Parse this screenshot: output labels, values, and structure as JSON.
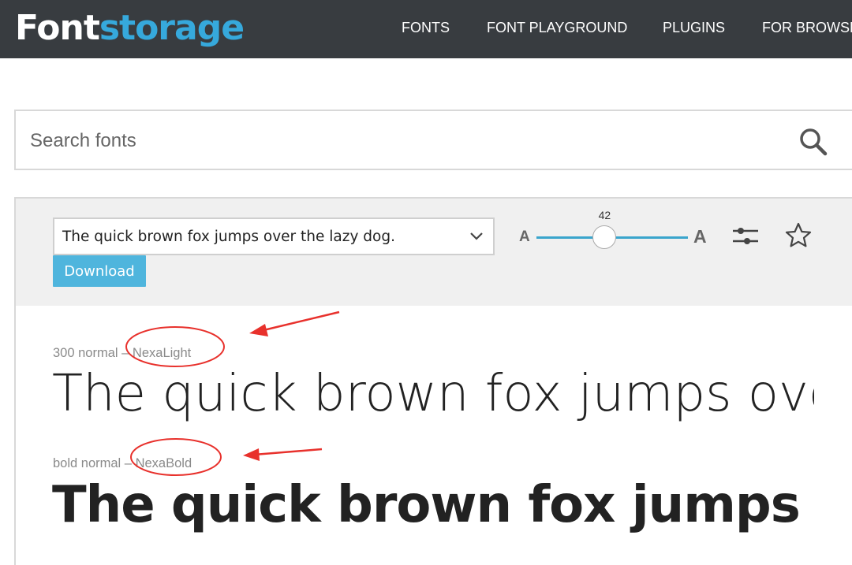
{
  "header": {
    "logo_part1": "Font",
    "logo_part2": "storage",
    "nav": [
      "FONTS",
      "FONT PLAYGROUND",
      "PLUGINS",
      "FOR BROWSE"
    ]
  },
  "search": {
    "placeholder": "Search fonts",
    "icon": "search-icon"
  },
  "controls": {
    "sample_text": "The quick brown fox jumps over the lazy dog.",
    "download_label": "Download",
    "size_min_label": "A",
    "size_max_label": "A",
    "size_value": "42",
    "size_fraction": 0.45
  },
  "fonts": [
    {
      "meta": "300 normal",
      "name": "NexaLight",
      "preview": "The quick brown fox jumps over the lazy dog."
    },
    {
      "meta": "bold normal",
      "name": "NexaBold",
      "preview": "The quick brown fox jumps over the lazy dog."
    }
  ],
  "colors": {
    "header_bg": "#383c40",
    "brand_accent": "#36a9dc",
    "button_bg": "#4fb5dd",
    "annotation_red": "#e8312c"
  }
}
